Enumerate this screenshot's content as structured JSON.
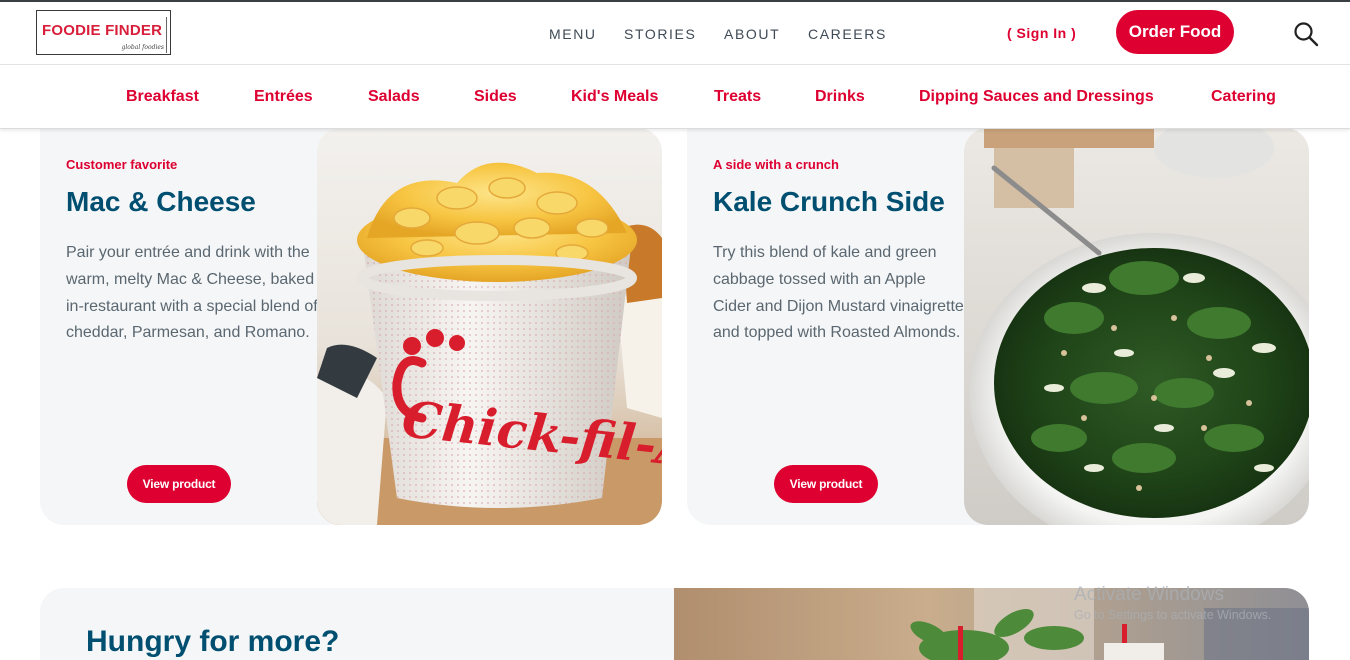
{
  "header": {
    "logo": {
      "text": "FOODIE FINDER",
      "tagline": "global foodies"
    },
    "nav": [
      {
        "label": "MENU"
      },
      {
        "label": "STORIES"
      },
      {
        "label": "ABOUT"
      },
      {
        "label": "CAREERS"
      }
    ],
    "sign_in_label": "( Sign In )",
    "order_button_label": "Order Food",
    "search_icon": "search-icon"
  },
  "categories": [
    {
      "label": "Breakfast"
    },
    {
      "label": "Entrées"
    },
    {
      "label": "Salads"
    },
    {
      "label": "Sides"
    },
    {
      "label": "Kid's Meals"
    },
    {
      "label": "Treats"
    },
    {
      "label": "Drinks"
    },
    {
      "label": "Dipping Sauces and Dressings"
    },
    {
      "label": "Catering"
    }
  ],
  "cards": [
    {
      "kicker": "Customer favorite",
      "title": "Mac & Cheese",
      "description": "Pair your entrée and drink with the warm, melty Mac & Cheese, baked in-restaurant with a special blend of cheddar, Parmesan, and Romano.",
      "button_label": "View product",
      "image_brand": "Chick-fil-A"
    },
    {
      "kicker": "A side with a crunch",
      "title": "Kale Crunch Side",
      "description": "Try this blend of kale and green cabbage tossed with an Apple Cider and Dijon Mustard vinaigrette and topped with Roasted Almonds.",
      "button_label": "View product"
    }
  ],
  "banner": {
    "title": "Hungry for more?"
  },
  "watermark": {
    "line1": "Activate Windows",
    "line2": "Go to Settings to activate Windows."
  },
  "colors": {
    "brand_red": "#dd0031",
    "title_blue": "#004f71",
    "card_bg": "#f4f6f7",
    "text_gray": "#5b6770"
  }
}
